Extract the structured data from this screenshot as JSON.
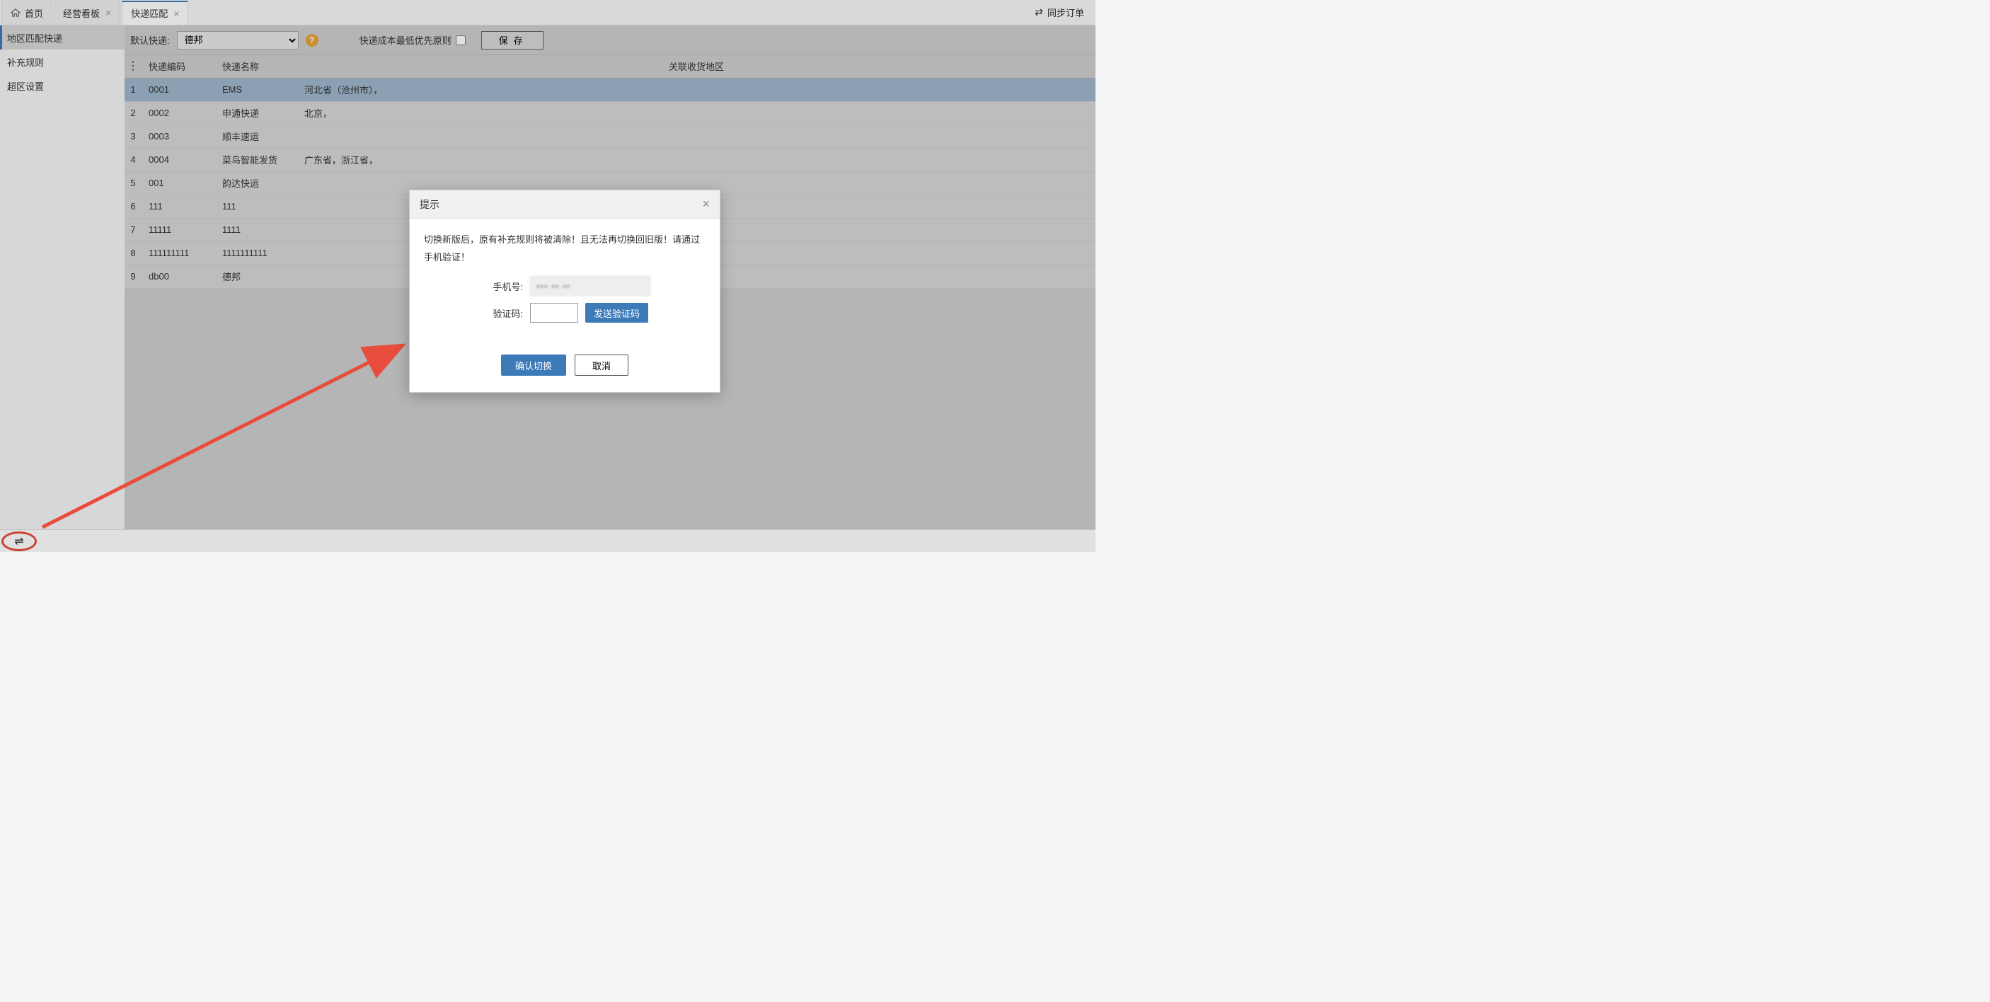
{
  "tabs": {
    "home": "首页",
    "dashboard": "经营看板",
    "express": "快递匹配"
  },
  "top_right": {
    "sync_label": "同步订单"
  },
  "sidebar": {
    "items": [
      {
        "label": "地区匹配快递"
      },
      {
        "label": "补充规则"
      },
      {
        "label": "超区设置"
      }
    ]
  },
  "toolbar": {
    "default_express_label": "默认快递:",
    "default_express_value": "德邦",
    "cost_priority_label": "快递成本最低优先原则",
    "save_label": "保存"
  },
  "table": {
    "headers": {
      "code": "快递编码",
      "name": "快递名称",
      "region": "关联收货地区"
    },
    "rows": [
      {
        "idx": "1",
        "code": "0001",
        "name": "EMS",
        "region": "河北省（沧州市），"
      },
      {
        "idx": "2",
        "code": "0002",
        "name": "申通快递",
        "region": "北京，"
      },
      {
        "idx": "3",
        "code": "0003",
        "name": "顺丰速运",
        "region": ""
      },
      {
        "idx": "4",
        "code": "0004",
        "name": "菜鸟智能发货",
        "region": "广东省，浙江省，"
      },
      {
        "idx": "5",
        "code": "001",
        "name": "韵达快运",
        "region": ""
      },
      {
        "idx": "6",
        "code": "111",
        "name": "111",
        "region": ""
      },
      {
        "idx": "7",
        "code": "11111",
        "name": "1111",
        "region": ""
      },
      {
        "idx": "8",
        "code": "111111111",
        "name": "1111111111",
        "region": ""
      },
      {
        "idx": "9",
        "code": "db00",
        "name": "德邦",
        "region": ""
      }
    ]
  },
  "dialog": {
    "title": "提示",
    "message": "切换新版后，原有补充规则将被清除！且无法再切换回旧版！请通过手机验证！",
    "phone_label": "手机号:",
    "phone_value": "••• •• ••",
    "code_label": "验证码:",
    "send_code_label": "发送验证码",
    "confirm_label": "确认切换",
    "cancel_label": "取消"
  }
}
